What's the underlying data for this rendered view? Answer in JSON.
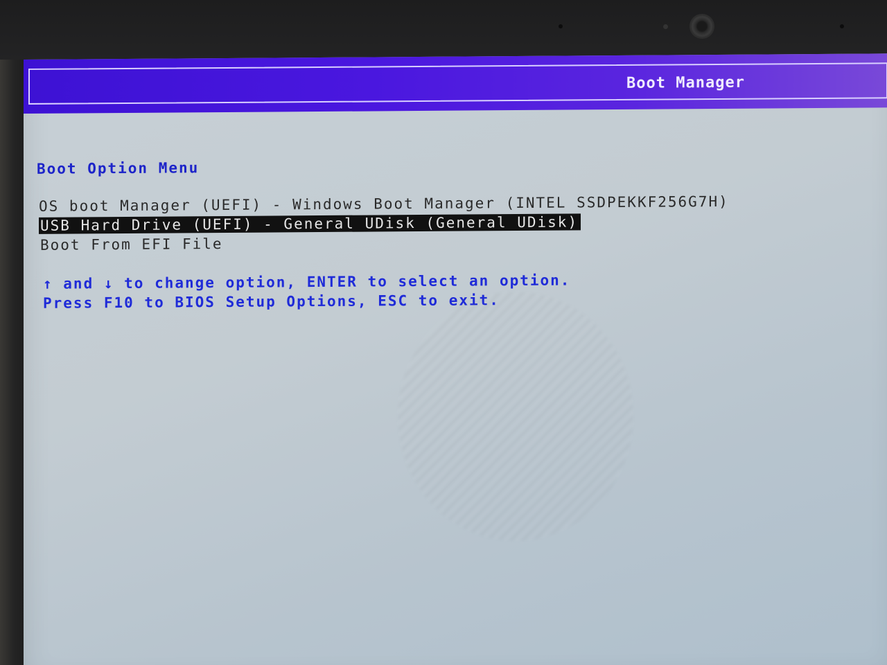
{
  "header": {
    "title": "Boot Manager"
  },
  "menu": {
    "title": "Boot Option Menu",
    "options": [
      {
        "label": "OS boot Manager (UEFI) - Windows Boot Manager (INTEL SSDPEKKF256G7H)",
        "selected": false
      },
      {
        "label": "USB Hard Drive (UEFI) - General UDisk (General UDisk)",
        "selected": true
      },
      {
        "label": "Boot From EFI File",
        "selected": false
      }
    ]
  },
  "help": {
    "line1": "↑ and ↓ to change option, ENTER to select an option.",
    "line2": "Press F10 to BIOS Setup Options, ESC to exit."
  },
  "colors": {
    "title_bar": "#4a17df",
    "menu_title": "#1d24c9",
    "help_text": "#1f2bd8",
    "selection_bg": "#111111",
    "screen_bg": "#c3ccd2"
  }
}
